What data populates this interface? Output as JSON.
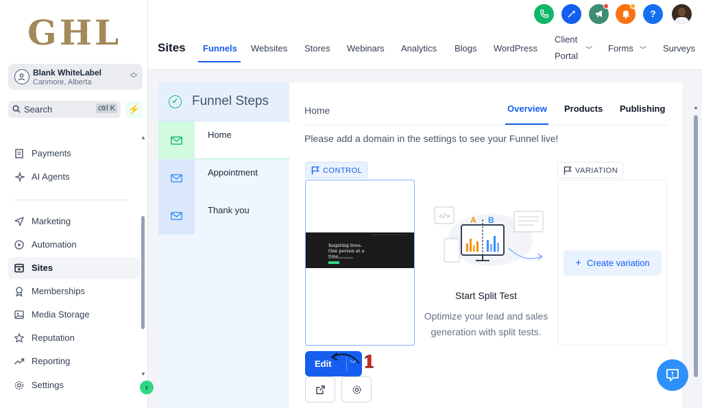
{
  "sidebar": {
    "logo": "GHL",
    "account": {
      "name": "Blank WhiteLabel",
      "location": "Canmore, Alberta"
    },
    "search": {
      "label": "Search",
      "shortcut": "ctrl K"
    },
    "items": [
      {
        "label": "Payments"
      },
      {
        "label": "AI Agents"
      },
      {
        "label": "Marketing"
      },
      {
        "label": "Automation"
      },
      {
        "label": "Sites"
      },
      {
        "label": "Memberships"
      },
      {
        "label": "Media Storage"
      },
      {
        "label": "Reputation"
      },
      {
        "label": "Reporting"
      },
      {
        "label": "Settings"
      }
    ]
  },
  "header": {
    "section_title": "Sites",
    "tabs": [
      {
        "label": "Funnels"
      },
      {
        "label": "Websites"
      },
      {
        "label": "Stores"
      },
      {
        "label": "Webinars"
      },
      {
        "label": "Analytics"
      },
      {
        "label": "Blogs"
      },
      {
        "label": "WordPress"
      },
      {
        "label_line1": "Client",
        "label_line2": "Portal"
      },
      {
        "label": "Forms"
      },
      {
        "label": "Surveys"
      }
    ],
    "help_label": "?",
    "colors": {
      "phone": "#12b76a",
      "magic": "#155eef",
      "announce": "#3e8e74",
      "notify": "#f97316",
      "help": "#1570ef"
    }
  },
  "funnel_steps": {
    "title": "Funnel Steps",
    "steps": [
      {
        "label": "Home"
      },
      {
        "label": "Appointment"
      },
      {
        "label": "Thank you"
      }
    ]
  },
  "main": {
    "breadcrumb": "Home",
    "tabs": [
      {
        "label": "Overview"
      },
      {
        "label": "Products"
      },
      {
        "label": "Publishing"
      }
    ],
    "notice": "Please add a domain in the settings to see your Funnel live!",
    "control_label": "CONTROL",
    "variation_label": "VARIATION",
    "preview": {
      "headline": "Inspiring lives.\nOne person at a\ntime."
    },
    "split_test": {
      "title": "Start Split Test",
      "description": "Optimize your lead and sales generation with split tests.",
      "label_a": "A",
      "label_b": "B"
    },
    "create_variation_label": "Create variation",
    "edit_label": "Edit",
    "annotation_number": "1"
  }
}
